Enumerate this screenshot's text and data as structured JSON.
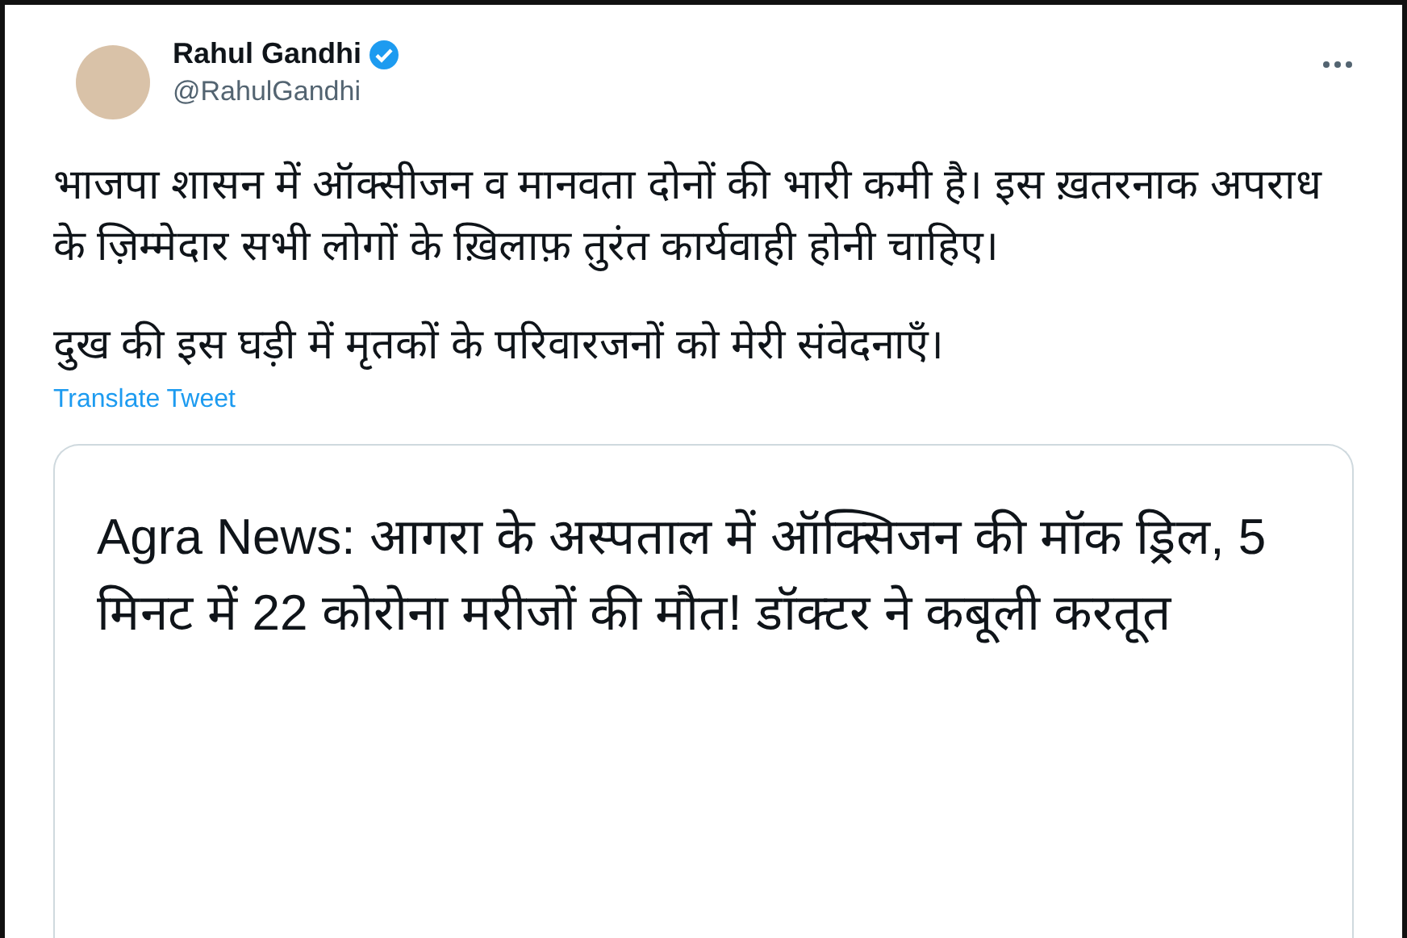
{
  "author": {
    "name": "Rahul Gandhi",
    "handle": "@RahulGandhi",
    "verified": true
  },
  "paragraphs": [
    "भाजपा शासन में ऑक्सीजन व मानवता दोनों की भारी कमी है। इस ख़तरनाक अपराध के ज़िम्मेदार सभी लोगों के ख़िलाफ़ तुरंत कार्यवाही होनी चाहिए।",
    "दुख की इस घड़ी में मृतकों के परिवारजनों को मेरी संवेदनाएँ।"
  ],
  "translate_link": "Translate Tweet",
  "link_card": {
    "title": "Agra News: आगरा के अस्पताल में ऑक्सिजन की मॉक ड्रिल, 5 मिनट में 22 कोरोना मरीजों की मौत! डॉक्टर ने कबूली करतूत"
  }
}
